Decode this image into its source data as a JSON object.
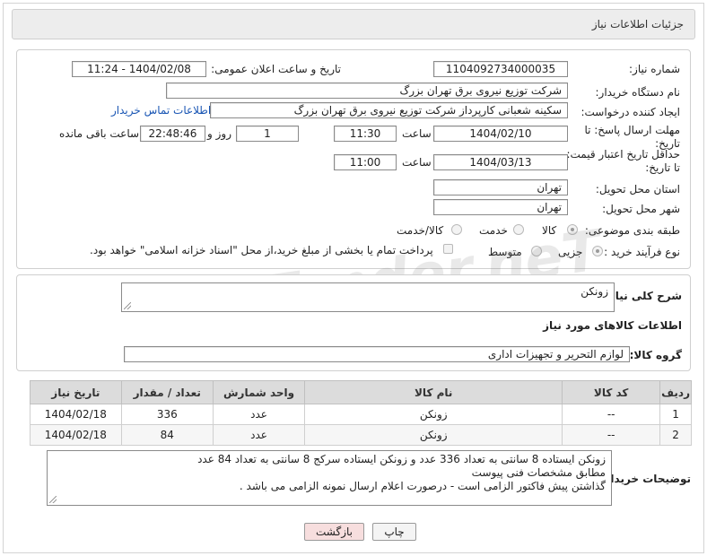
{
  "header": {
    "title": "جزئیات اطلاعات نیاز"
  },
  "form": {
    "need_number_label": "شماره نیاز:",
    "need_number_value": "1104092734000035",
    "announce_label": "تاریخ و ساعت اعلان عمومی:",
    "announce_value": "1404/02/08 - 11:24",
    "buyer_org_label": "نام دستگاه خریدار:",
    "buyer_org_value": "شرکت توزیع نیروی برق تهران بزرگ",
    "requester_label": "ایجاد کننده درخواست:",
    "requester_value": "سکینه شعبانی کارپرداز شرکت توزیع نیروی برق تهران بزرگ",
    "buyer_contact_link": "اطلاعات تماس خریدار",
    "deadline_label": "مهلت ارسال پاسخ: تا تاریخ:",
    "deadline_date": "1404/02/10",
    "time_label": "ساعت",
    "deadline_time": "11:30",
    "days_value": "1",
    "days_label": "روز و",
    "remaining_value": "22:48:46",
    "remaining_label": "ساعت باقی مانده",
    "price_validity_label": "حداقل تاریخ اعتبار قیمت: تا تاریخ:",
    "price_validity_date": "1404/03/13",
    "price_validity_time": "11:00",
    "province_label": "استان محل تحویل:",
    "province_value": "تهران",
    "city_label": "شهر محل تحویل:",
    "city_value": "تهران",
    "category_label": "طبقه بندی موضوعی:",
    "category_options": [
      "کالا",
      "خدمت",
      "کالا/خدمت"
    ],
    "category_selected": "کالا",
    "process_label": "نوع فرآیند خرید :",
    "process_options": [
      "جزیی",
      "متوسط"
    ],
    "process_selected": "جزیی",
    "payment_note": "پرداخت تمام یا بخشی از مبلغ خرید،از محل \"اسناد خزانه اسلامی\" خواهد بود."
  },
  "description": {
    "label": "شرح کلی نیاز:",
    "value": "زونکن"
  },
  "goods": {
    "section_title": "اطلاعات کالاهای مورد نیاز",
    "group_label": "گروه کالا:",
    "group_value": "لوازم التحریر و تجهیزات اداری",
    "columns": [
      "ردیف",
      "کد کالا",
      "نام کالا",
      "واحد شمارش",
      "تعداد / مقدار",
      "تاریخ نیاز"
    ],
    "rows": [
      {
        "row": "1",
        "code": "--",
        "name": "زونکن",
        "unit": "عدد",
        "qty": "336",
        "date": "1404/02/18"
      },
      {
        "row": "2",
        "code": "--",
        "name": "زونکن",
        "unit": "عدد",
        "qty": "84",
        "date": "1404/02/18"
      }
    ]
  },
  "buyer_notes": {
    "label": "توضیحات خریدار:",
    "lines": [
      "زونکن ایستاده 8 سانتی به تعداد 336 عدد و زونکن ایستاده سرکج 8 سانتی به تعداد 84 عدد",
      "مطابق مشخصات فنی پیوست",
      "گذاشتن پیش فاکتور الزامی است - درصورت اعلام ارسال نمونه الزامی می باشد ."
    ]
  },
  "buttons": {
    "print": "چاپ",
    "back": "بازگشت"
  },
  "watermark": {
    "text": "AriaTender.neT"
  },
  "colors": {
    "link": "#1a56b4",
    "back_button_bg": "#f7dede",
    "print_button_bg": "#f4f4f4"
  }
}
